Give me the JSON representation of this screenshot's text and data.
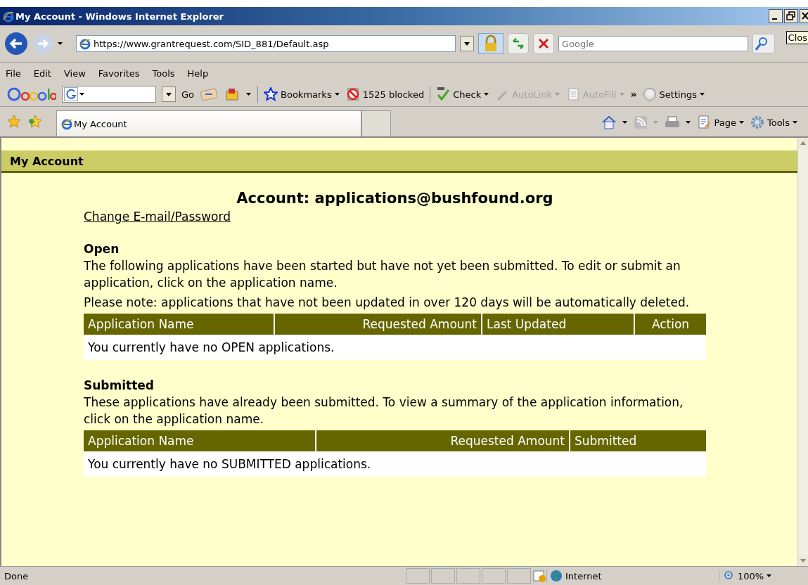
{
  "window": {
    "title": "My Account - Windows Internet Explorer"
  },
  "address_bar": {
    "value": "https://www.grantrequest.com/SID_881/Default.asp"
  },
  "search": {
    "placeholder": "Google"
  },
  "tooltip": "Clos",
  "menu": [
    "File",
    "Edit",
    "View",
    "Favorites",
    "Tools",
    "Help"
  ],
  "google_toolbar": [
    {
      "kind": "go",
      "label": "Go"
    },
    {
      "kind": "bookmarks",
      "label": "Bookmarks",
      "disabled": false
    },
    {
      "kind": "blocked",
      "label": "1525 blocked",
      "disabled": false
    },
    {
      "kind": "check",
      "label": "Check",
      "disabled": false
    },
    {
      "kind": "autolink",
      "label": "AutoLink",
      "disabled": true
    },
    {
      "kind": "autofill",
      "label": "AutoFill",
      "disabled": true
    },
    {
      "kind": "more",
      "label": "»"
    },
    {
      "kind": "settings",
      "label": "Settings",
      "disabled": false
    }
  ],
  "tabs": [
    {
      "label": "My Account",
      "selected": true
    }
  ],
  "command_bar": [
    "Page",
    "Tools"
  ],
  "page": {
    "header": "My Account",
    "heading": "Account: applications@bushfound.org",
    "link": "Change E-mail/Password",
    "sections": [
      {
        "title": "Open",
        "paragraphs": [
          "The following applications have been started but have not yet been submitted. To edit or submit an application, click on the application name.",
          "Please note: applications that have not been updated in over 120 days will be automatically deleted."
        ],
        "columns": [
          "Application Name",
          "Requested Amount",
          "Last Updated",
          "Action"
        ],
        "empty": "You currently have no OPEN applications."
      },
      {
        "title": "Submitted",
        "paragraphs": [
          "These applications have already been submitted. To view a summary of the application information, click on the application name."
        ],
        "columns": [
          "Application Name",
          "Requested Amount",
          "Submitted"
        ],
        "empty": "You currently have no SUBMITTED applications."
      }
    ]
  },
  "status_bar": {
    "text": "Done",
    "zone": "Internet",
    "zoom": "100%"
  }
}
